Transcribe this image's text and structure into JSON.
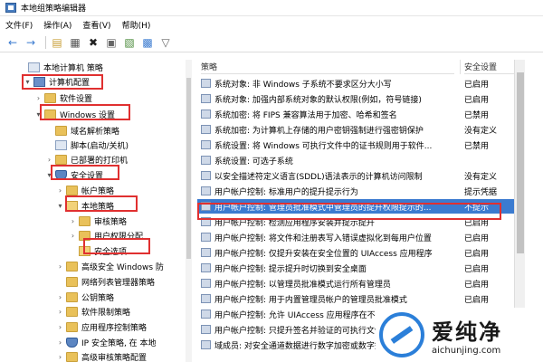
{
  "window": {
    "title": "本地组策略编辑器"
  },
  "menu": [
    "文件(F)",
    "操作(A)",
    "查看(V)",
    "帮助(H)"
  ],
  "toolbar": [
    "back-icon",
    "forward-icon",
    "up-folder-icon",
    "show-tree-icon",
    "delete-icon",
    "properties-icon",
    "export-icon",
    "help-icon",
    "filter-icon"
  ],
  "tree": [
    {
      "label": "本地计算机 策略",
      "expander": "",
      "icon": "policydoc"
    },
    {
      "label": "计算机配置",
      "expander": "▾",
      "icon": "computer"
    },
    {
      "label": "软件设置",
      "expander": "›",
      "icon": "folder"
    },
    {
      "label": "Windows 设置",
      "expander": "▾",
      "icon": "folder"
    },
    {
      "label": "域名解析策略",
      "expander": "",
      "icon": "folder"
    },
    {
      "label": "脚本(启动/关机)",
      "expander": "",
      "icon": "policydoc"
    },
    {
      "label": "已部署的打印机",
      "expander": "›",
      "icon": "folder"
    },
    {
      "label": "安全设置",
      "expander": "▾",
      "icon": "shield"
    },
    {
      "label": "帐户策略",
      "expander": "›",
      "icon": "folder"
    },
    {
      "label": "本地策略",
      "expander": "▾",
      "icon": "folder-open"
    },
    {
      "label": "审核策略",
      "expander": "›",
      "icon": "folder"
    },
    {
      "label": "用户权限分配",
      "expander": "›",
      "icon": "folder"
    },
    {
      "label": "安全选项",
      "expander": "",
      "icon": "folder-open"
    },
    {
      "label": "高级安全 Windows 防",
      "expander": "›",
      "icon": "folder"
    },
    {
      "label": "网络列表管理器策略",
      "expander": "",
      "icon": "folder"
    },
    {
      "label": "公钥策略",
      "expander": "›",
      "icon": "folder"
    },
    {
      "label": "软件限制策略",
      "expander": "›",
      "icon": "folder"
    },
    {
      "label": "应用程序控制策略",
      "expander": "›",
      "icon": "folder"
    },
    {
      "label": "IP 安全策略, 在 本地",
      "expander": "›",
      "icon": "shield"
    },
    {
      "label": "高级审核策略配置",
      "expander": "›",
      "icon": "folder"
    }
  ],
  "columns": {
    "policy": "策略",
    "setting": "安全设置"
  },
  "policies": [
    {
      "name": "系统对象: 非 Windows 子系统不要求区分大小写",
      "setting": "已启用"
    },
    {
      "name": "系统对象: 加强内部系统对象的默认权限(例如，符号链接)",
      "setting": "已启用"
    },
    {
      "name": "系统加密: 将 FIPS 兼容算法用于加密、哈希和签名",
      "setting": "已禁用"
    },
    {
      "name": "系统加密: 为计算机上存储的用户密钥强制进行强密钥保护",
      "setting": "没有定义"
    },
    {
      "name": "系统设置: 将 Windows 可执行文件中的证书规则用于软件...",
      "setting": "已禁用"
    },
    {
      "name": "系统设置: 可选子系统",
      "setting": ""
    },
    {
      "name": "以安全描述符定义语言(SDDL)语法表示的计算机访问限制",
      "setting": "没有定义"
    },
    {
      "name": "用户帐户控制: 标准用户的提升提示行为",
      "setting": "提示凭据"
    },
    {
      "name": "用户帐户控制: 管理员批准模式中管理员的提升权限提示的...",
      "setting": "不提示"
    },
    {
      "name": "用户帐户控制: 检测应用程序安装并提示提升",
      "setting": "已启用"
    },
    {
      "name": "用户帐户控制: 将文件和注册表写入错误虚拟化到每用户位置",
      "setting": "已启用"
    },
    {
      "name": "用户帐户控制: 仅提升安装在安全位置的 UIAccess 应用程序",
      "setting": "已启用"
    },
    {
      "name": "用户帐户控制: 提示提升时切换到安全桌面",
      "setting": "已启用"
    },
    {
      "name": "用户帐户控制: 以管理员批准模式运行所有管理员",
      "setting": "已启用"
    },
    {
      "name": "用户帐户控制: 用于内置管理员帐户的管理员批准模式",
      "setting": "已启用"
    },
    {
      "name": "用户帐户控制: 允许 UIAccess 应用程序在不使用安全桌面...",
      "setting": "已禁用"
    },
    {
      "name": "用户帐户控制: 只提升签名并验证的可执行文件",
      "setting": "已禁用"
    },
    {
      "name": "域成员: 对安全通道数据进行数字加密或数字签名(始终)",
      "setting": "已启用"
    }
  ],
  "selected_policy_index": 8,
  "watermark": {
    "cn": "爱纯净",
    "url": "aichunjing.com"
  },
  "colors": {
    "selection": "#3b7bd0",
    "highlight_box": "#e03030",
    "watermark_blue": "#2b7fd9"
  }
}
